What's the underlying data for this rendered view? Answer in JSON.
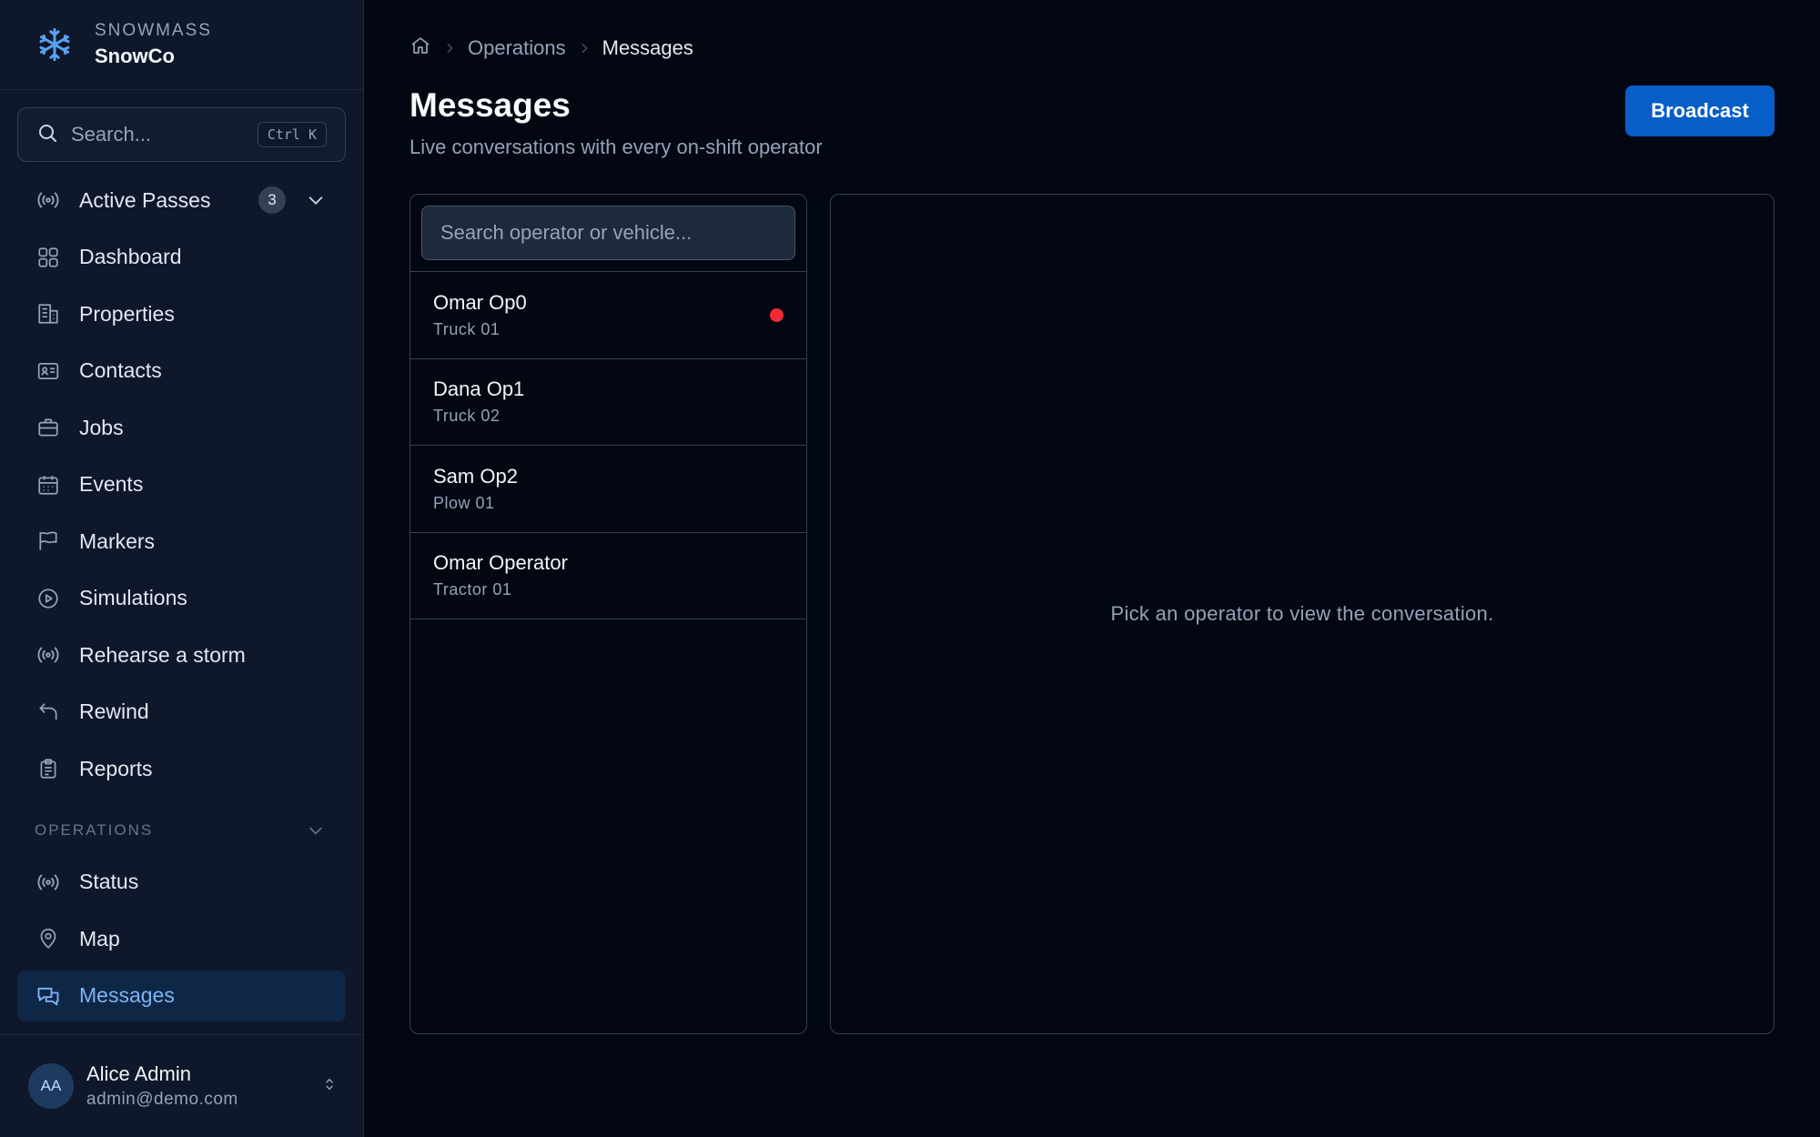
{
  "brand": {
    "org": "SNOWMASS",
    "name": "SnowCo"
  },
  "search": {
    "placeholder": "Search...",
    "shortcut": "Ctrl K"
  },
  "sidebar": {
    "items": [
      {
        "label": "Active Passes",
        "icon": "broadcast-icon",
        "badge": "3"
      },
      {
        "label": "Dashboard",
        "icon": "grid-icon"
      },
      {
        "label": "Properties",
        "icon": "building-icon"
      },
      {
        "label": "Contacts",
        "icon": "id-card-icon"
      },
      {
        "label": "Jobs",
        "icon": "briefcase-icon"
      },
      {
        "label": "Events",
        "icon": "calendar-icon"
      },
      {
        "label": "Markers",
        "icon": "flag-icon"
      },
      {
        "label": "Simulations",
        "icon": "play-circle-icon"
      },
      {
        "label": "Rehearse a storm",
        "icon": "broadcast-icon"
      },
      {
        "label": "Rewind",
        "icon": "undo-icon"
      },
      {
        "label": "Reports",
        "icon": "clipboard-icon"
      }
    ],
    "section": {
      "title": "OPERATIONS",
      "items": [
        {
          "label": "Status",
          "icon": "broadcast-icon"
        },
        {
          "label": "Map",
          "icon": "map-pin-icon"
        },
        {
          "label": "Messages",
          "icon": "chat-icon",
          "active": true
        }
      ]
    }
  },
  "user": {
    "initials": "AA",
    "name": "Alice Admin",
    "email": "admin@demo.com"
  },
  "breadcrumb": {
    "parent": "Operations",
    "current": "Messages"
  },
  "page": {
    "title": "Messages",
    "subtitle": "Live conversations with every on-shift operator",
    "broadcast_label": "Broadcast"
  },
  "operators": {
    "search_placeholder": "Search operator or vehicle...",
    "list": [
      {
        "name": "Omar Op0",
        "vehicle": "Truck 01",
        "unread": true
      },
      {
        "name": "Dana Op1",
        "vehicle": "Truck 02",
        "unread": false
      },
      {
        "name": "Sam Op2",
        "vehicle": "Plow 01",
        "unread": false
      },
      {
        "name": "Omar Operator",
        "vehicle": "Tractor 01",
        "unread": false
      }
    ]
  },
  "conversation": {
    "empty_text": "Pick an operator to view the conversation."
  },
  "colors": {
    "accent": "#075ec6",
    "unread_dot": "#ef2b36",
    "active_nav_bg": "#0f2746",
    "background": "#030712"
  }
}
